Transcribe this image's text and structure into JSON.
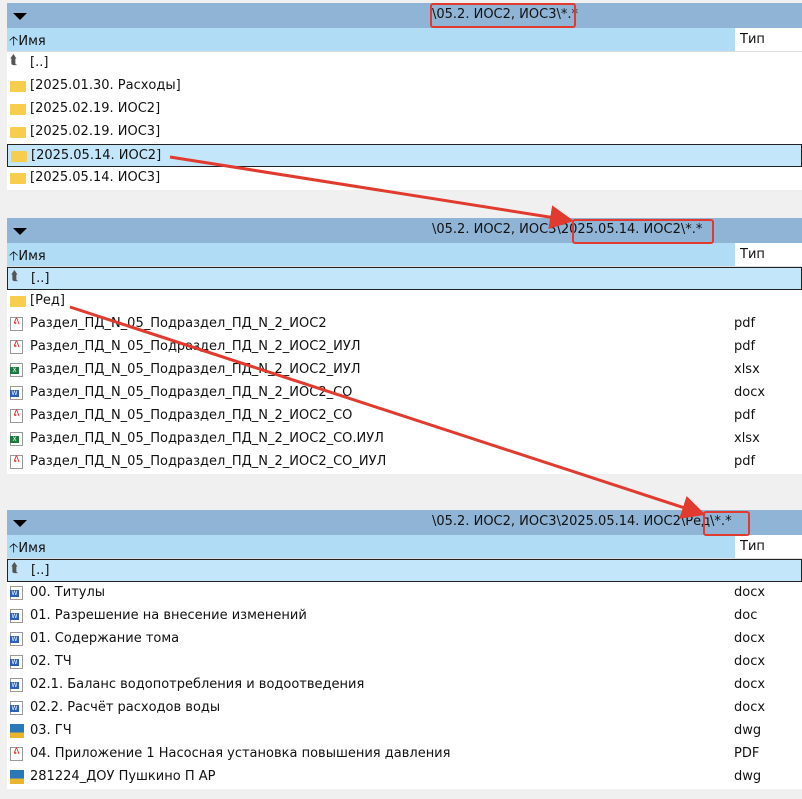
{
  "panels": [
    {
      "path": "\\05.2. ИОС2, ИОС3\\*.*",
      "col_name": "Имя",
      "col_type": "Тип",
      "rows": [
        {
          "icon": "up-folder-icon",
          "name": "[..]",
          "type": ""
        },
        {
          "icon": "folder-icon",
          "name": "[2025.01.30. Расходы]",
          "type": ""
        },
        {
          "icon": "folder-icon",
          "name": "[2025.02.19. ИОС2]",
          "type": ""
        },
        {
          "icon": "folder-icon",
          "name": "[2025.02.19. ИОС3]",
          "type": ""
        },
        {
          "icon": "folder-icon",
          "name": "[2025.05.14. ИОС2]",
          "type": "",
          "selected": true
        },
        {
          "icon": "folder-icon",
          "name": "[2025.05.14. ИОС3]",
          "type": ""
        }
      ]
    },
    {
      "path": "\\05.2. ИОС2, ИОС3\\2025.05.14. ИОС2\\*.*",
      "col_name": "Имя",
      "col_type": "Тип",
      "rows": [
        {
          "icon": "up-folder-icon",
          "name": "[..]",
          "type": "",
          "selected": true
        },
        {
          "icon": "folder-icon",
          "name": "[Ред]",
          "type": ""
        },
        {
          "icon": "pdf-icon",
          "name": "Раздел_ПД_N_05_Подраздел_ПД_N_2_ИОС2",
          "type": "pdf"
        },
        {
          "icon": "pdf-icon",
          "name": "Раздел_ПД_N_05_Подраздел_ПД_N_2_ИОС2_ИУЛ",
          "type": "pdf"
        },
        {
          "icon": "excel-icon",
          "name": "Раздел_ПД_N_05_Подраздел_ПД_N_2_ИОС2_ИУЛ",
          "type": "xlsx"
        },
        {
          "icon": "word-icon",
          "name": "Раздел_ПД_N_05_Подраздел_ПД_N_2_ИОС2_СО",
          "type": "docx"
        },
        {
          "icon": "pdf-icon",
          "name": "Раздел_ПД_N_05_Подраздел_ПД_N_2_ИОС2_СО",
          "type": "pdf"
        },
        {
          "icon": "excel-icon",
          "name": "Раздел_ПД_N_05_Подраздел_ПД_N_2_ИОС2_СО.ИУЛ",
          "type": "xlsx"
        },
        {
          "icon": "pdf-icon",
          "name": "Раздел_ПД_N_05_Подраздел_ПД_N_2_ИОС2_СО_ИУЛ",
          "type": "pdf"
        }
      ]
    },
    {
      "path": "\\05.2. ИОС2, ИОС3\\2025.05.14. ИОС2\\Ред\\*.*",
      "col_name": "Имя",
      "col_type": "Тип",
      "rows": [
        {
          "icon": "up-folder-icon",
          "name": "[..]",
          "type": "",
          "selected": true
        },
        {
          "icon": "word-icon",
          "name": "00. Титулы",
          "type": "docx"
        },
        {
          "icon": "word-icon",
          "name": "01. Разрешение на внесение изменений",
          "type": "doc"
        },
        {
          "icon": "word-icon",
          "name": "01. Содержание тома",
          "type": "docx"
        },
        {
          "icon": "word-icon",
          "name": "02. ТЧ",
          "type": "docx"
        },
        {
          "icon": "word-icon",
          "name": "02.1. Баланс водопотребления и водоотведения",
          "type": "docx"
        },
        {
          "icon": "word-icon",
          "name": "02.2. Расчёт расходов воды",
          "type": "docx"
        },
        {
          "icon": "dwg-icon",
          "name": "03. ГЧ",
          "type": "dwg"
        },
        {
          "icon": "pdf-icon",
          "name": "04. Приложение 1 Насосная установка повышения давления",
          "type": "PDF"
        },
        {
          "icon": "dwg-icon",
          "name": "281224_ДОУ Пушкино П АР",
          "type": "dwg"
        }
      ]
    }
  ],
  "colors": {
    "pathbar": "#8fb4d6",
    "header": "#b0dcf5",
    "selection": "#c4e6fb",
    "annotation": "#e03b2e"
  }
}
